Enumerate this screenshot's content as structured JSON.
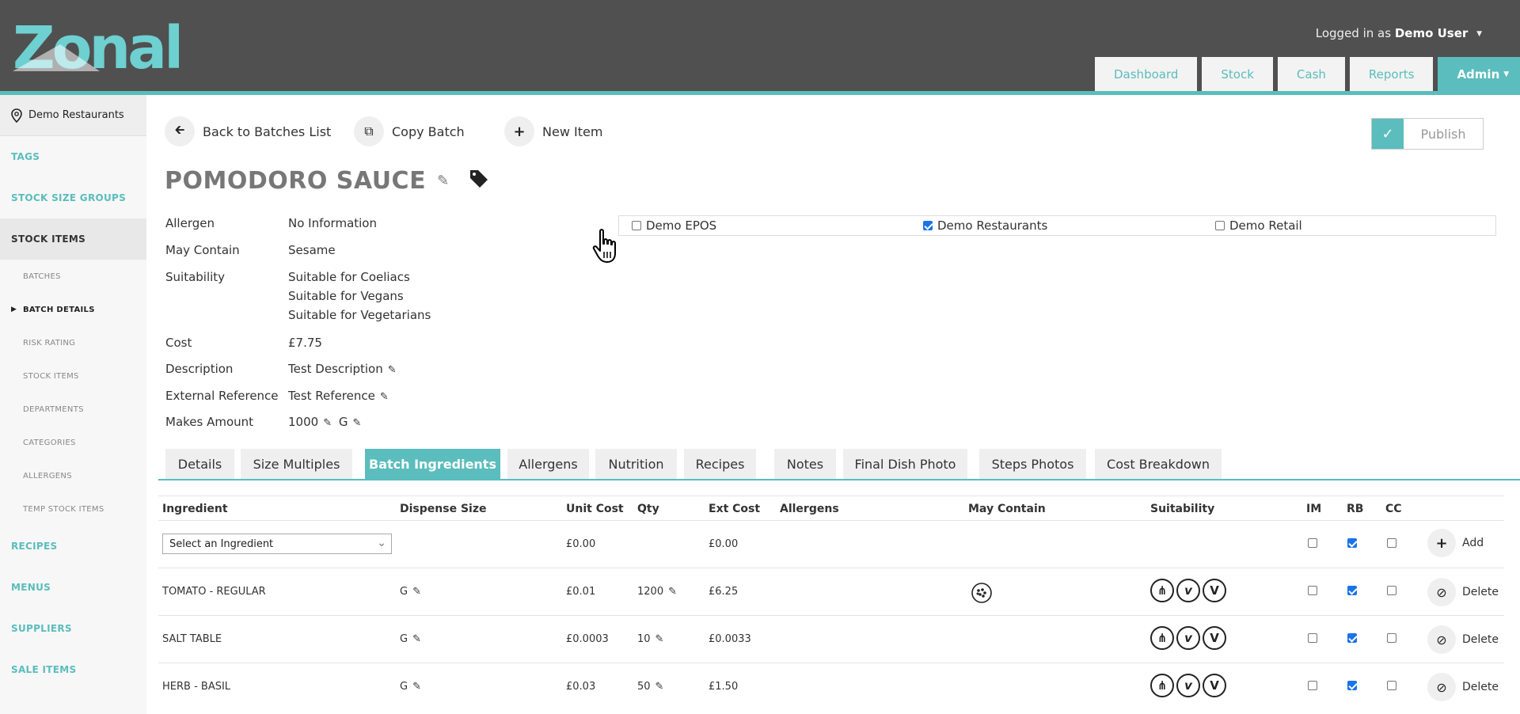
{
  "header": {
    "logo_text": "Zonal",
    "user_prefix": "Logged in as",
    "user_name": "Demo User",
    "nav": [
      "Dashboard",
      "Stock",
      "Cash",
      "Reports",
      "Admin"
    ]
  },
  "sidebar": {
    "location": "Demo Restaurants",
    "items": {
      "tags": "TAGS",
      "stock_size_groups": "STOCK SIZE GROUPS",
      "stock_items": "STOCK ITEMS",
      "batches": "BATCHES",
      "batch_details": "BATCH DETAILS",
      "risk_rating": "RISK RATING",
      "stock_items_sub": "STOCK ITEMS",
      "departments": "DEPARTMENTS",
      "categories": "CATEGORIES",
      "allergens": "ALLERGENS",
      "temp_stock_items": "TEMP STOCK ITEMS",
      "recipes": "RECIPES",
      "menus": "MENUS",
      "suppliers": "SUPPLIERS",
      "sale_items": "SALE ITEMS"
    }
  },
  "toolbar": {
    "back": "Back to Batches List",
    "copy": "Copy Batch",
    "new_item": "New Item",
    "publish": "Publish"
  },
  "batch": {
    "title": "POMODORO SAUCE",
    "allergen_label": "Allergen",
    "allergen_value": "No Information",
    "may_contain_label": "May Contain",
    "may_contain_value": "Sesame",
    "suitability_label": "Suitability",
    "suitability_values": [
      "Suitable for Coeliacs",
      "Suitable for Vegans",
      "Suitable for Vegetarians"
    ],
    "cost_label": "Cost",
    "cost_value": "£7.75",
    "description_label": "Description",
    "description_value": "Test Description",
    "external_ref_label": "External Reference",
    "external_ref_value": "Test Reference",
    "makes_amount_label": "Makes Amount",
    "makes_amount_value": "1000",
    "makes_amount_unit": "G"
  },
  "sites": [
    {
      "name": "Demo EPOS",
      "checked": false
    },
    {
      "name": "Demo Restaurants",
      "checked": true
    },
    {
      "name": "Demo Retail",
      "checked": false
    }
  ],
  "tabs": [
    "Details",
    "Size Multiples",
    "Batch Ingredients",
    "Allergens",
    "Nutrition",
    "Recipes",
    "Notes",
    "Final Dish Photo",
    "Steps Photos",
    "Cost Breakdown"
  ],
  "table": {
    "headers": {
      "ingredient": "Ingredient",
      "dispense": "Dispense Size",
      "unit_cost": "Unit Cost",
      "qty": "Qty",
      "ext_cost": "Ext Cost",
      "allergens": "Allergens",
      "may_contain": "May Contain",
      "suitability": "Suitability",
      "im": "IM",
      "rb": "RB",
      "cc": "CC"
    },
    "new_row": {
      "select_placeholder": "Select an Ingredient",
      "unit_cost": "£0.00",
      "ext_cost": "£0.00",
      "add_label": "Add"
    },
    "rows": [
      {
        "name": "TOMATO - REGULAR",
        "dispense": "G",
        "unit_cost": "£0.01",
        "qty": "1200",
        "ext_cost": "£6.25",
        "delete_label": "Delete"
      },
      {
        "name": "SALT TABLE",
        "dispense": "G",
        "unit_cost": "£0.0003",
        "qty": "10",
        "ext_cost": "£0.0033",
        "delete_label": "Delete"
      },
      {
        "name": "HERB - BASIL",
        "dispense": "G",
        "unit_cost": "£0.03",
        "qty": "50",
        "ext_cost": "£1.50",
        "delete_label": "Delete"
      }
    ]
  },
  "colors": {
    "accent": "#5bbdbd",
    "header_bg": "#505050"
  }
}
